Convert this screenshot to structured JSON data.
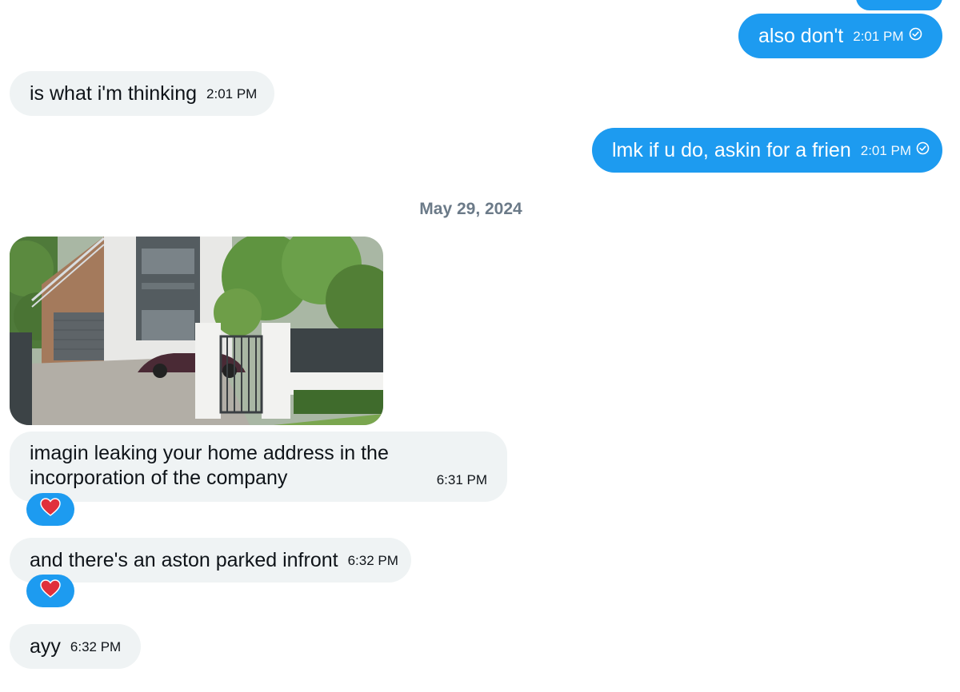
{
  "colors": {
    "outgoing_bubble": "#1d9bf0",
    "incoming_bubble": "#eff3f4",
    "date_text": "#6b7a88",
    "reaction_bg": "#1d9bf0"
  },
  "messages": {
    "m0": {
      "sender": "me",
      "text": "also don't",
      "time": "2:01 PM",
      "status_icon": "sent-check-icon"
    },
    "m1": {
      "sender": "them",
      "text": "is what i'm thinking",
      "time": "2:01 PM"
    },
    "m2": {
      "sender": "me",
      "text": "lmk if u do, askin for a frien",
      "time": "2:01 PM",
      "status_icon": "sent-check-icon"
    },
    "date_separator": "May 29, 2024",
    "m3": {
      "sender": "them",
      "type": "image",
      "image_description_icon": "house-photo"
    },
    "m4": {
      "sender": "them",
      "text_line1": "imagin leaking your home address in the",
      "text_line2": "incorporation of the company",
      "time": "6:31 PM",
      "reaction": "red-heart"
    },
    "m5": {
      "sender": "them",
      "text": "and there's an aston parked infront",
      "time": "6:32 PM",
      "reaction": "red-heart"
    },
    "m6": {
      "sender": "them",
      "text": "ayy",
      "time": "6:32 PM"
    }
  }
}
